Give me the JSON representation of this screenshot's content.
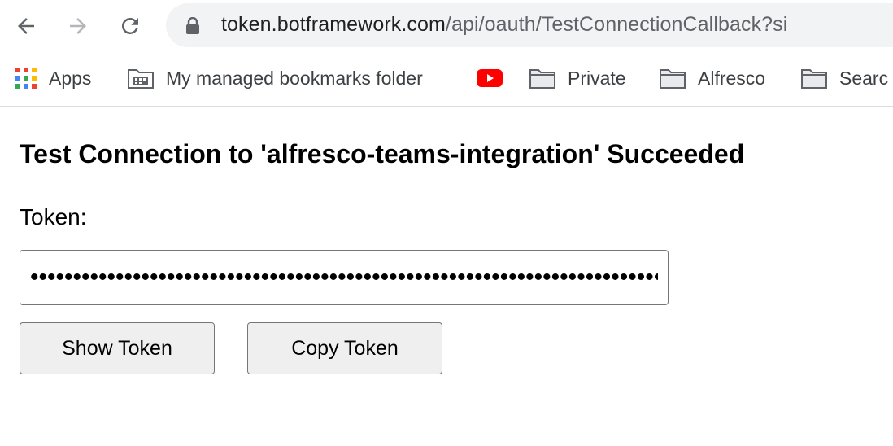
{
  "browser": {
    "url_host": "token.botframework.com",
    "url_path": "/api/oauth/TestConnectionCallback?si"
  },
  "bookmarks": [
    {
      "label": "Apps",
      "icon": "apps-grid-icon"
    },
    {
      "label": "My managed bookmarks folder",
      "icon": "managed-folder-icon"
    },
    {
      "label": "",
      "icon": "youtube-icon"
    },
    {
      "label": "Private",
      "icon": "folder-icon"
    },
    {
      "label": "Alfresco",
      "icon": "folder-icon"
    },
    {
      "label": "Searc",
      "icon": "folder-icon"
    }
  ],
  "page": {
    "title": "Test Connection to 'alfresco-teams-integration' Succeeded",
    "token_label": "Token:",
    "token_value": "••••••••••••••••••••••••••••••••••••••••••••••••••••••••••••••••••••••••••••••••",
    "show_token_label": "Show Token",
    "copy_token_label": "Copy Token"
  },
  "colors": {
    "youtube_red": "#ff0000",
    "apps_red": "#ea4335",
    "apps_yellow": "#fbbc04",
    "apps_green": "#34a853",
    "apps_blue": "#4285f4"
  }
}
